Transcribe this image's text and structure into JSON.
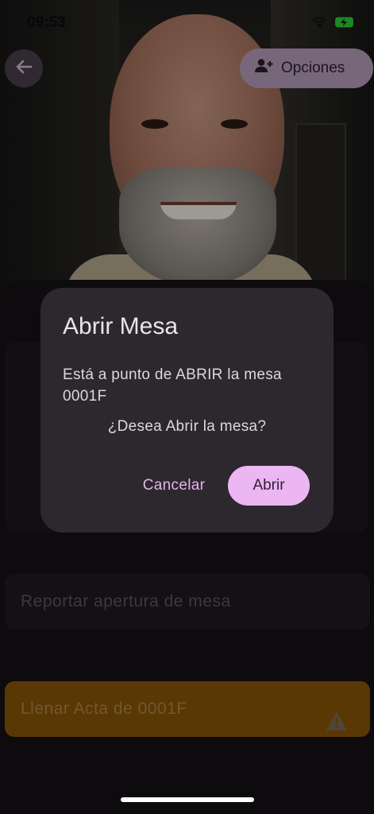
{
  "status_bar": {
    "time": "09:53"
  },
  "top_bar": {
    "options_label": "Opciones"
  },
  "form": {
    "report_placeholder": "Reportar apertura de mesa",
    "fill_button_label": "Llenar Acta de 0001F"
  },
  "dialog": {
    "title": "Abrir Mesa",
    "message": "Está a punto de ABRIR la mesa 0001F",
    "question": "¿Desea Abrir la mesa?",
    "cancel_label": "Cancelar",
    "confirm_label": "Abrir"
  },
  "icons": {
    "back": "arrow-left",
    "options": "person-add",
    "warning": "warning-triangle",
    "wifi": "wifi",
    "battery": "battery-charging"
  },
  "colors": {
    "dialog_bg": "#2d282e",
    "accent": "#ecb6f2",
    "fill_button": "#8a5707",
    "options_button": "#b89dbd"
  }
}
